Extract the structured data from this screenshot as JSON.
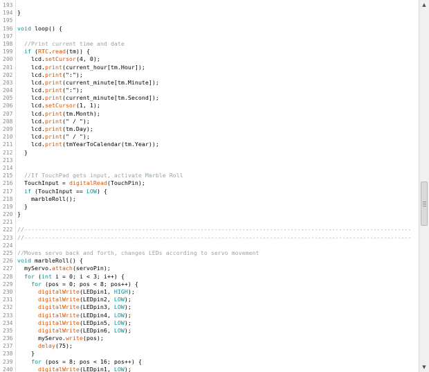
{
  "editor": {
    "lines": [
      {
        "num": "193",
        "text": ""
      },
      {
        "num": "194",
        "text": "}"
      },
      {
        "num": "195",
        "text": ""
      },
      {
        "num": "196",
        "text": "void loop() {"
      },
      {
        "num": "197",
        "text": ""
      },
      {
        "num": "198",
        "text": "  //Print current time and date"
      },
      {
        "num": "199",
        "text": "  if (RTC.read(tm)) {"
      },
      {
        "num": "200",
        "text": "    lcd.setCursor(4, 0);"
      },
      {
        "num": "201",
        "text": "    lcd.print(current_hour[tm.Hour]);"
      },
      {
        "num": "202",
        "text": "    lcd.print(\":\");"
      },
      {
        "num": "203",
        "text": "    lcd.print(current_minute[tm.Minute]);"
      },
      {
        "num": "204",
        "text": "    lcd.print(\":\");"
      },
      {
        "num": "205",
        "text": "    lcd.print(current_minute[tm.Second]);"
      },
      {
        "num": "206",
        "text": "    lcd.setCursor(1, 1);"
      },
      {
        "num": "207",
        "text": "    lcd.print(tm.Month);"
      },
      {
        "num": "208",
        "text": "    lcd.print(\" / \");"
      },
      {
        "num": "209",
        "text": "    lcd.print(tm.Day);"
      },
      {
        "num": "210",
        "text": "    lcd.print(\" / \");"
      },
      {
        "num": "211",
        "text": "    lcd.print(tmYearToCalendar(tm.Year));"
      },
      {
        "num": "212",
        "text": "  }"
      },
      {
        "num": "213",
        "text": ""
      },
      {
        "num": "214",
        "text": ""
      },
      {
        "num": "215",
        "text": "  //If TouchPad gets input, activate Marble Roll"
      },
      {
        "num": "216",
        "text": "  TouchInput = digitalRead(TouchPin);"
      },
      {
        "num": "217",
        "text": "  if (TouchInput == LOW) {"
      },
      {
        "num": "218",
        "text": "    marbleRoll();"
      },
      {
        "num": "219",
        "text": "  }"
      },
      {
        "num": "220",
        "text": "}"
      },
      {
        "num": "221",
        "text": ""
      },
      {
        "num": "222",
        "text": "//----------------------------------------------------------------------------------------------------------------"
      },
      {
        "num": "223",
        "text": "//----------------------------------------------------------------------------------------------------------------"
      },
      {
        "num": "224",
        "text": ""
      },
      {
        "num": "225",
        "text": "//Moves servo back and forth, changes LEDs according to servo movement"
      },
      {
        "num": "226",
        "text": "void marbleRoll() {"
      },
      {
        "num": "227",
        "text": "  myServo.attach(servoPin);"
      },
      {
        "num": "228",
        "text": "  for (int i = 0; i < 3; i++) {"
      },
      {
        "num": "229",
        "text": "    for (pos = 0; pos < 8; pos++) {"
      },
      {
        "num": "230",
        "text": "      digitalWrite(LEDpin1, HIGH);"
      },
      {
        "num": "231",
        "text": "      digitalWrite(LEDpin2, LOW);"
      },
      {
        "num": "232",
        "text": "      digitalWrite(LEDpin3, LOW);"
      },
      {
        "num": "233",
        "text": "      digitalWrite(LEDpin4, LOW);"
      },
      {
        "num": "234",
        "text": "      digitalWrite(LEDpin5, LOW);"
      },
      {
        "num": "235",
        "text": "      digitalWrite(LEDpin6, LOW);"
      },
      {
        "num": "236",
        "text": "      myServo.write(pos);"
      },
      {
        "num": "237",
        "text": "      delay(75);"
      },
      {
        "num": "238",
        "text": "    }"
      },
      {
        "num": "239",
        "text": "    for (pos = 8; pos < 16; pos++) {"
      },
      {
        "num": "240",
        "text": "      digitalWrite(LEDpin1, LOW);"
      }
    ],
    "colors": {
      "keyword": "#00979c",
      "function": "#d35400",
      "comment": "#95a5a6",
      "line_number": "#8a8a8a",
      "text": "#000000"
    }
  },
  "scrollbar": {
    "up_icon": "scroll-up-arrow-icon",
    "down_icon": "scroll-down-arrow-icon",
    "position_fraction": 0.56
  }
}
